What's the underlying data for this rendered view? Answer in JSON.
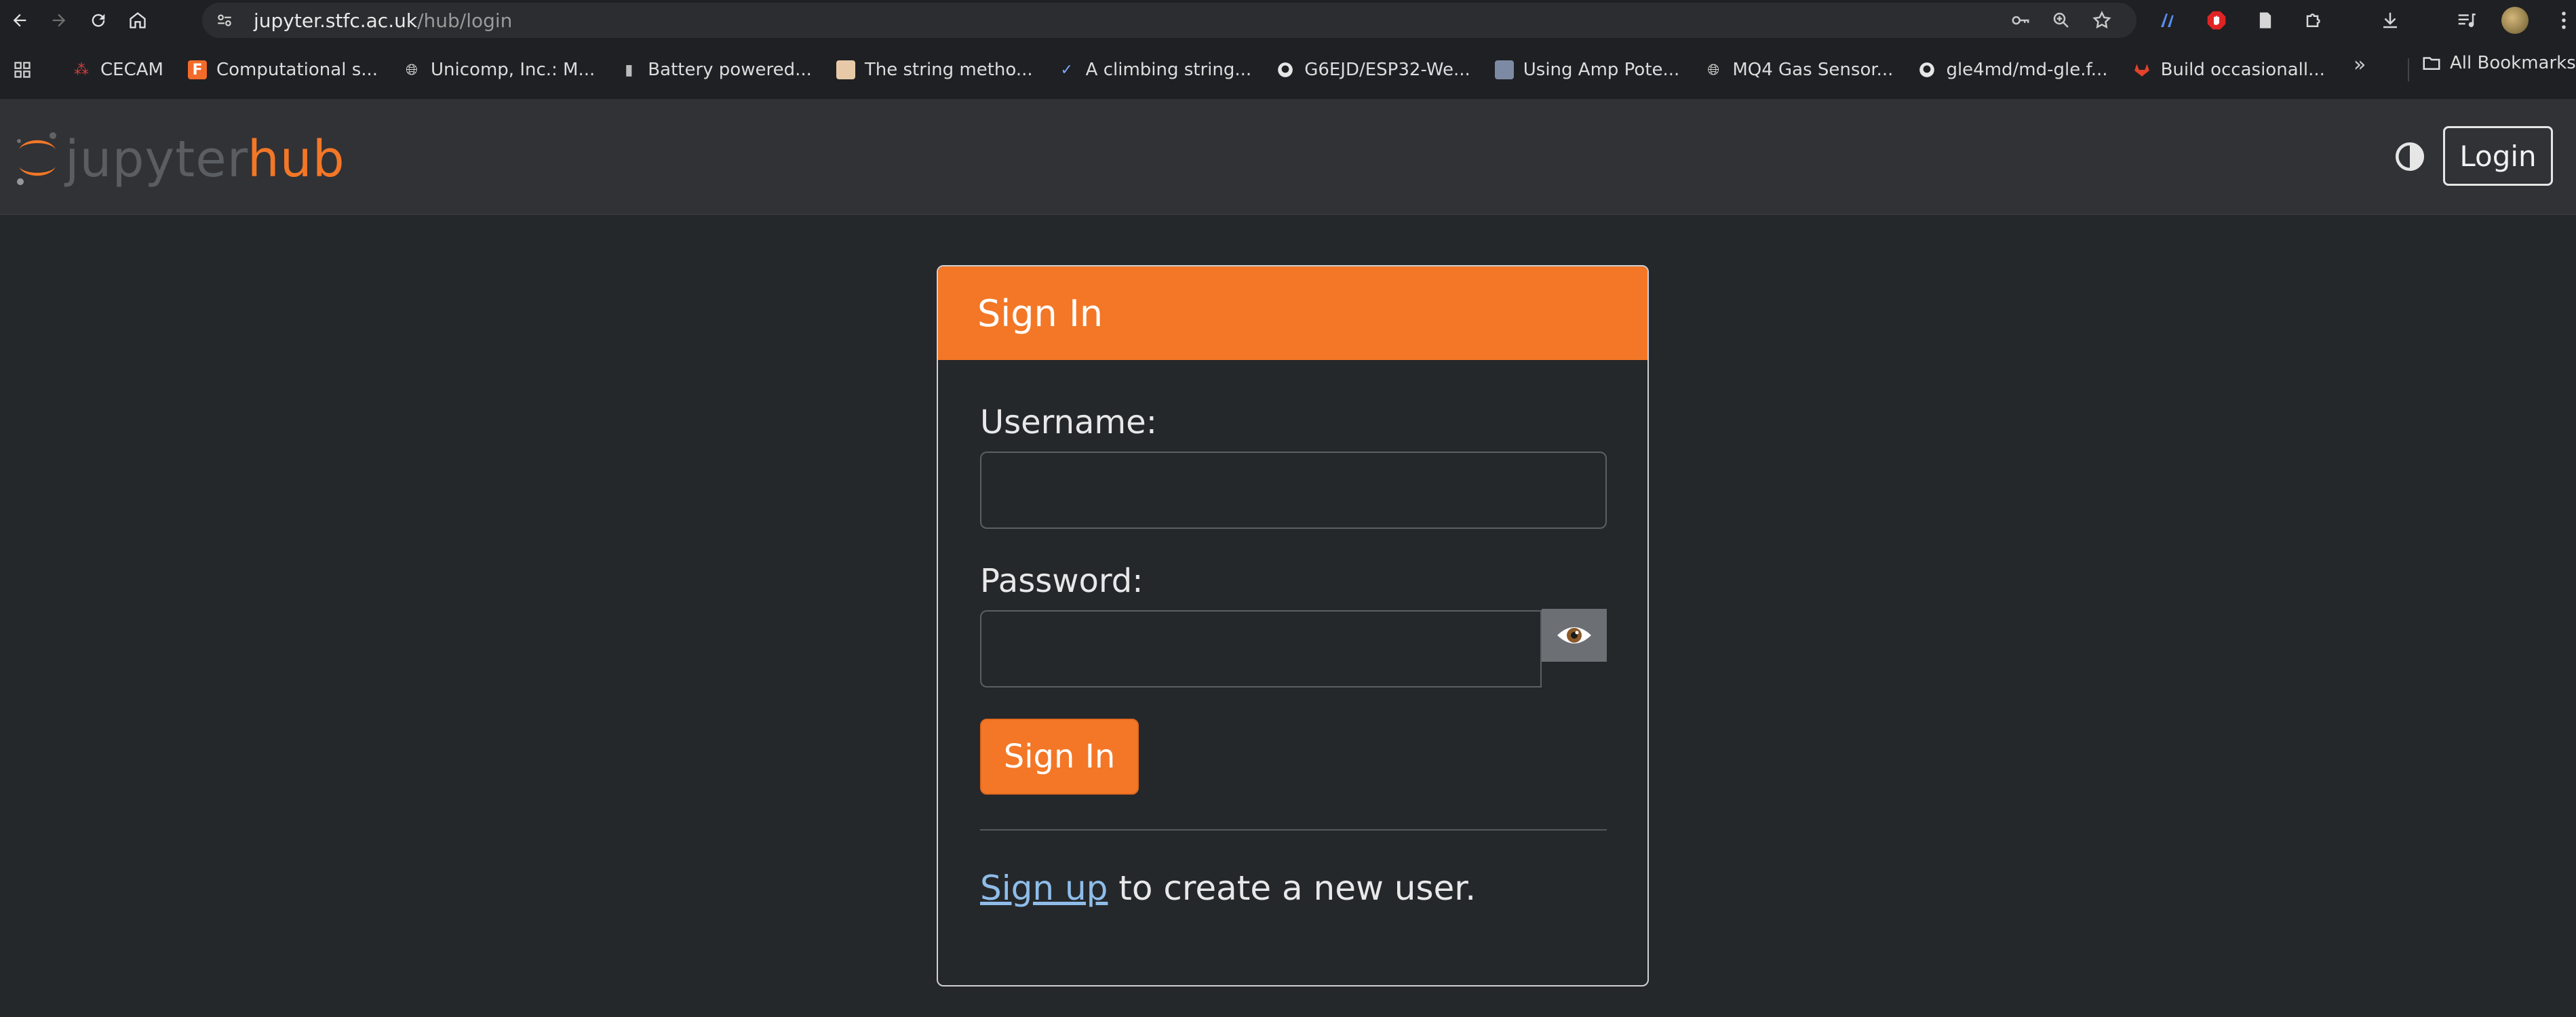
{
  "browser": {
    "url_host": "jupyter.stfc.ac.uk",
    "url_path": "/hub/login",
    "bookmarks": [
      {
        "label": "CECAM",
        "icon": "cecam-icon"
      },
      {
        "label": "Computational s...",
        "icon": "f-logo-icon"
      },
      {
        "label": "Unicomp, Inc.: M...",
        "icon": "globe-icon"
      },
      {
        "label": "Battery powered...",
        "icon": "battery-icon"
      },
      {
        "label": "The string metho...",
        "icon": "page-icon"
      },
      {
        "label": "A climbing string...",
        "icon": "check-icon"
      },
      {
        "label": "G6EJD/ESP32-We...",
        "icon": "github-icon"
      },
      {
        "label": "Using Amp Pote...",
        "icon": "grid-icon"
      },
      {
        "label": "MQ4 Gas Sensor...",
        "icon": "globe-icon"
      },
      {
        "label": "gle4md/md-gle.f...",
        "icon": "github-icon"
      },
      {
        "label": "Build occasionall...",
        "icon": "gitlab-icon"
      }
    ],
    "all_bookmarks_label": "All Bookmarks"
  },
  "header": {
    "logo_jupyter": "jupyter",
    "logo_hub": "hub",
    "login_label": "Login"
  },
  "login_form": {
    "title": "Sign In",
    "username_label": "Username:",
    "username_value": "",
    "password_label": "Password:",
    "password_value": "",
    "submit_label": "Sign In",
    "signup_link": "Sign up",
    "signup_text": " to create a new user."
  },
  "colors": {
    "accent": "#f37726",
    "page_bg": "#25282b",
    "header_bg": "#303236",
    "link": "#8fbde9"
  }
}
